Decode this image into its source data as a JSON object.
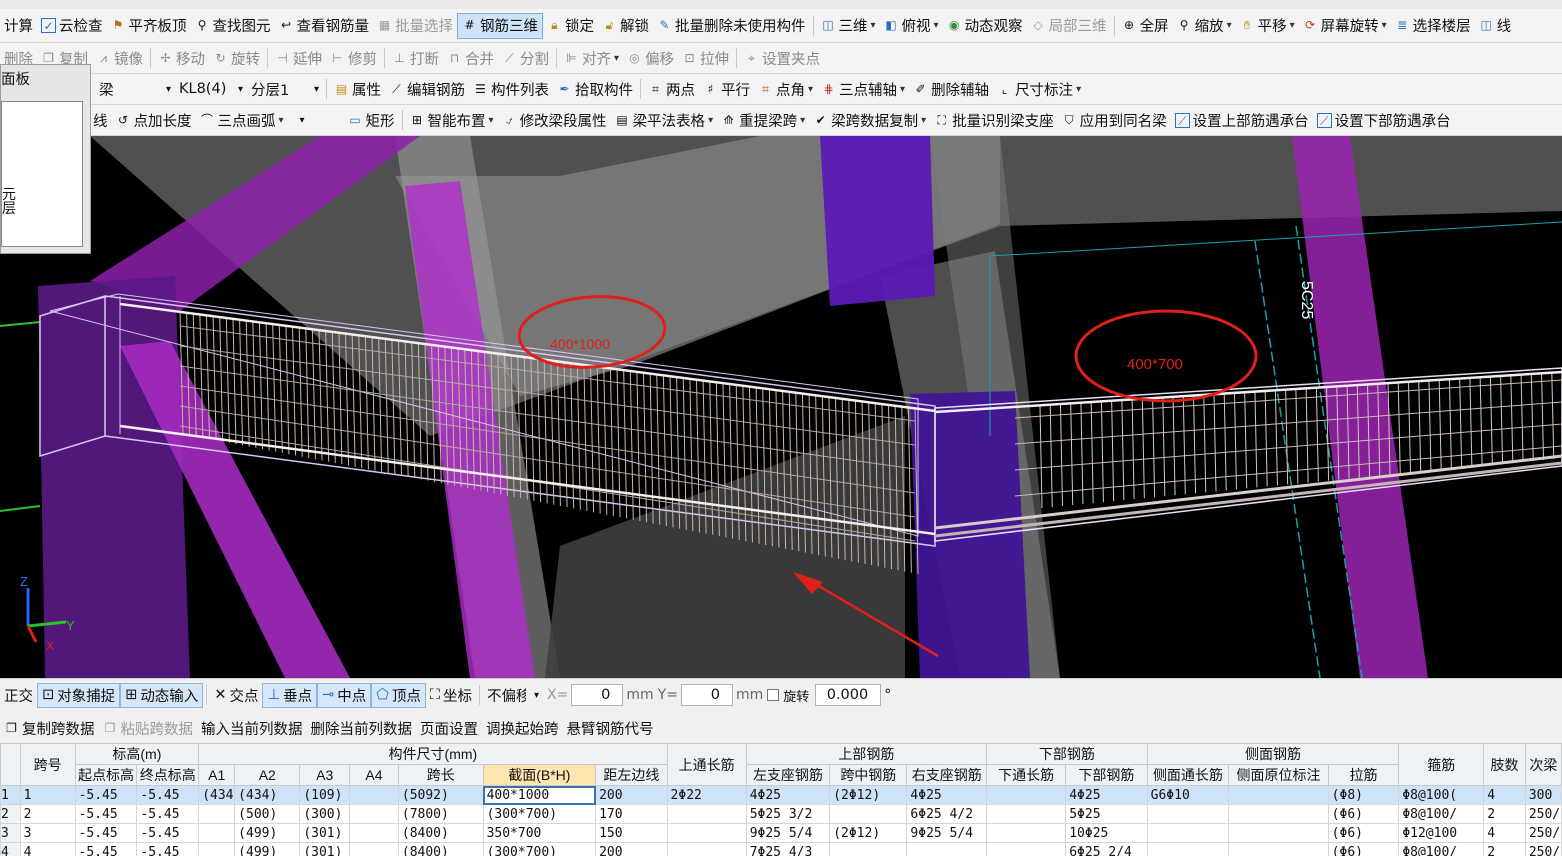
{
  "toolbar1": {
    "calc": "计算",
    "cloud_check": "云检查",
    "flush_slab": "平齐板顶",
    "find_element": "查找图元",
    "view_rebar_qty": "查看钢筋量",
    "batch_select": "批量选择",
    "rebar_3d": "钢筋三维",
    "lock": "锁定",
    "unlock": "解锁",
    "batch_delete_unused": "批量删除未使用构件",
    "three_d": "三维",
    "top_view": "俯视",
    "dynamic_observe": "动态观察",
    "local_3d": "局部三维",
    "fullscreen": "全屏",
    "zoom": "缩放",
    "pan": "平移",
    "screen_rotate": "屏幕旋转",
    "select_floor": "选择楼层",
    "trailing": "线"
  },
  "toolbar2": {
    "delete": "删除",
    "copy": "复制",
    "mirror": "镜像",
    "move": "移动",
    "rotate": "旋转",
    "extend": "延伸",
    "trim": "修剪",
    "break": "打断",
    "merge": "合并",
    "split": "分割",
    "align": "对齐",
    "offset": "偏移",
    "stretch": "拉伸",
    "set_grip": "设置夹点"
  },
  "toolbar3": {
    "type_combo": "梁",
    "element_combo": "KL8(4)",
    "layer_combo": "分层1",
    "properties": "属性",
    "edit_rebar": "编辑钢筋",
    "element_list": "构件列表",
    "pick_element": "拾取构件",
    "two_points": "两点",
    "parallel": "平行",
    "point_angle": "点角",
    "three_point_axis": "三点辅轴",
    "delete_axis": "删除辅轴",
    "dimension": "尺寸标注"
  },
  "toolbar4": {
    "line": "线",
    "point_length": "点加长度",
    "three_point_arc": "三点画弧",
    "rectangle": "矩形",
    "smart_place": "智能布置",
    "modify_span_props": "修改梁段属性",
    "beam_table": "梁平法表格",
    "re_extract_span": "重提梁跨",
    "copy_span_data": "梁跨数据复制",
    "batch_identify_support": "批量识别梁支座",
    "apply_same_name": "应用到同名梁",
    "set_top_rebar_cap": "设置上部筋遇承台",
    "set_bottom_rebar_cap": "设置下部筋遇承台"
  },
  "panel": {
    "title": "图层面板",
    "title_visible": "面板",
    "fragment": "元\n层"
  },
  "viewport": {
    "annotation_left": "400*1000",
    "annotation_right": "400*700",
    "side_text": "5C25",
    "axis_z": "Z",
    "axis_y": "Y",
    "axis_x": "X",
    "colors": {
      "column": "#9b22b6",
      "annotation": "#e0201a",
      "rebar": "#c8b8b0",
      "axis_line": "#1aa0a8"
    }
  },
  "snapbar": {
    "ortho": "正交",
    "object_snap": "对象捕捉",
    "dynamic_input": "动态输入",
    "intersection": "交点",
    "perpendicular": "垂点",
    "midpoint": "中点",
    "vertex": "顶点",
    "coordinate": "坐标",
    "offset_mode": "不偏移",
    "x_label": "X=",
    "x_value": "0",
    "unit": "mm",
    "y_label": "Y=",
    "y_value": "0",
    "rotate_label": "旋转",
    "rotate_value": "0.000",
    "degree": "°"
  },
  "tablebar": {
    "copy_span": "复制跨数据",
    "paste_span": "粘贴跨数据",
    "input_column": "输入当前列数据",
    "delete_column": "删除当前列数据",
    "page_setup": "页面设置",
    "swap_start": "调换起始跨",
    "cantilever_code": "悬臂钢筋代号"
  },
  "table": {
    "group_headers": {
      "span": "跨号",
      "elevation": "标高(m)",
      "dims": "构件尺寸(mm)",
      "top_through": "上通长筋",
      "top_rebar": "上部钢筋",
      "bottom_rebar": "下部钢筋",
      "side_rebar": "侧面钢筋",
      "stirrup": "箍筋",
      "legs": "肢数",
      "next": "次梁"
    },
    "sub_headers": [
      "起点标高",
      "终点标高",
      "A1",
      "A2",
      "A3",
      "A4",
      "跨长",
      "截面(B*H)",
      "距左边线",
      "左支座钢筋",
      "跨中钢筋",
      "右支座钢筋",
      "下通长筋",
      "下部钢筋",
      "侧面通长筋",
      "侧面原位标注",
      "拉筋"
    ],
    "rows": [
      [
        "1",
        "1",
        "-5.45",
        "-5.45",
        "(434",
        "(434)",
        "(109)",
        "",
        "(5092)",
        "400*1000",
        "200",
        "2Φ22",
        "4Φ25",
        "(2Φ12)",
        "4Φ25",
        "",
        "4Φ25",
        "G6Φ10",
        "",
        "(Φ8)",
        "Φ8@100(",
        "4",
        "300"
      ],
      [
        "2",
        "2",
        "-5.45",
        "-5.45",
        "",
        "(500)",
        "(300)",
        "",
        "(7800)",
        "(300*700)",
        "170",
        "",
        "5Φ25 3/2",
        "",
        "6Φ25 4/2",
        "",
        "5Φ25",
        "",
        "",
        "(Φ6)",
        "Φ8@100/",
        "2",
        "250/"
      ],
      [
        "3",
        "3",
        "-5.45",
        "-5.45",
        "",
        "(499)",
        "(301)",
        "",
        "(8400)",
        "350*700",
        "150",
        "",
        "9Φ25 5/4",
        "(2Φ12)",
        "9Φ25 5/4",
        "",
        "10Φ25",
        "",
        "",
        "(Φ6)",
        "Φ12@100",
        "4",
        "250/"
      ],
      [
        "4",
        "4",
        "-5.45",
        "-5.45",
        "",
        "(499)",
        "(301)",
        "",
        "(8400)",
        "(300*700)",
        "200",
        "",
        "7Φ25 4/3",
        "",
        "",
        "",
        "6Φ25 2/4",
        "",
        "",
        "(Φ6)",
        "Φ8@100/",
        "2",
        "250/"
      ]
    ]
  }
}
